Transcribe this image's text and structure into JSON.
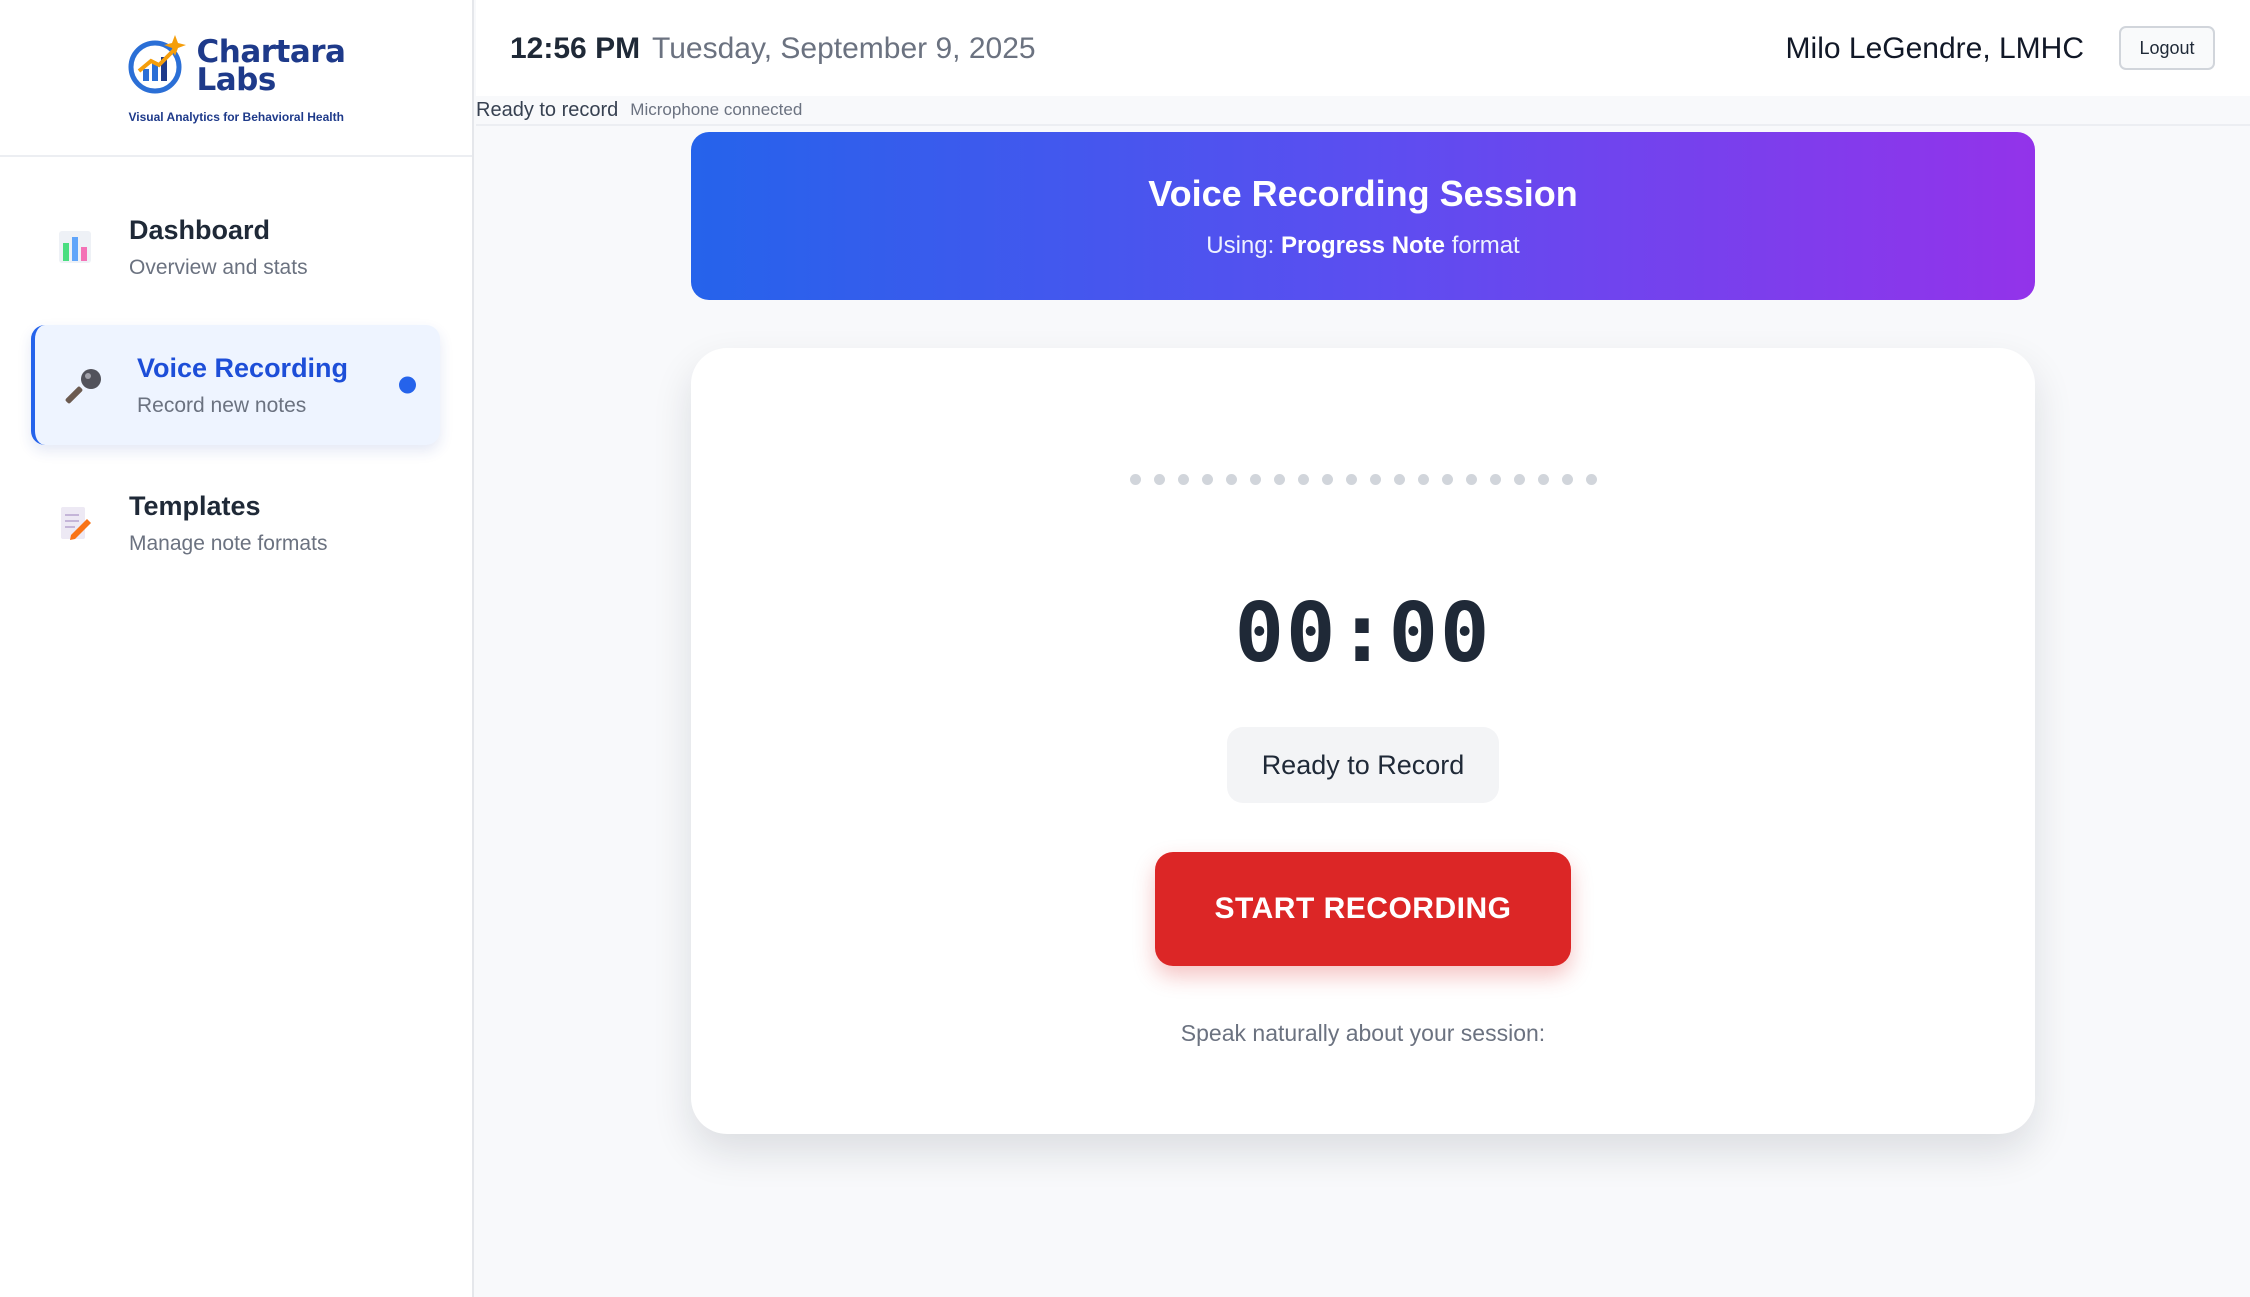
{
  "brand": {
    "name_line1": "Chartara",
    "name_line2": "Labs",
    "tagline": "Visual Analytics for Behavioral Health"
  },
  "sidebar": {
    "items": [
      {
        "icon": "bar-chart-icon",
        "title": "Dashboard",
        "subtitle": "Overview and stats"
      },
      {
        "icon": "microphone-icon",
        "title": "Voice Recording",
        "subtitle": "Record new notes"
      },
      {
        "icon": "notepad-pencil-icon",
        "title": "Templates",
        "subtitle": "Manage note formats"
      }
    ],
    "active_index": 1
  },
  "header": {
    "time": "12:56 PM",
    "date": "Tuesday, September 9, 2025",
    "user": "Milo LeGendre, LMHC",
    "logout_label": "Logout"
  },
  "status": {
    "main": "Ready to record",
    "mic": "Microphone connected"
  },
  "banner": {
    "title": "Voice Recording Session",
    "prefix": "Using:",
    "format": "Progress Note",
    "suffix": "format"
  },
  "recorder": {
    "timer": "00:00",
    "state": "Ready to Record",
    "start_label": "START RECORDING",
    "hint": "Speak naturally about your session:"
  },
  "colors": {
    "accent": "#2563eb",
    "record": "#dc2626",
    "gradient_start": "#2563eb",
    "gradient_end": "#9333ea",
    "brand": "#1e3a8a"
  }
}
